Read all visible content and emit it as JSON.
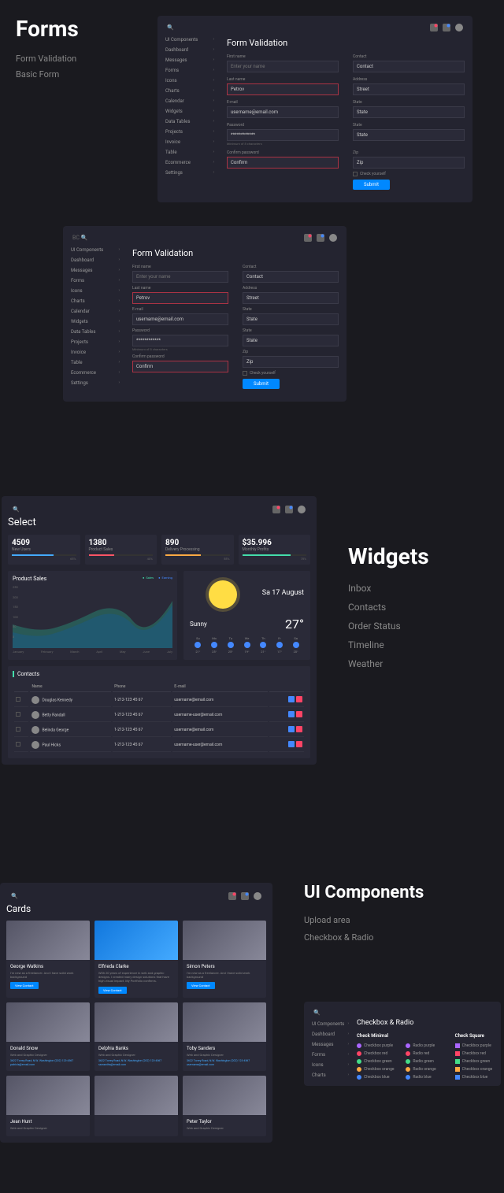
{
  "forms_section": {
    "title": "Forms",
    "links": [
      "Form Validation",
      "Basic Form"
    ]
  },
  "sidebar_items": [
    "UI Components",
    "Dashboard",
    "Messages",
    "Forms",
    "Icons",
    "Charts",
    "Calendar",
    "Widgets",
    "Data Tables",
    "Projects",
    "Invoice",
    "Table",
    "Ecommerce",
    "Settings"
  ],
  "form_validation": {
    "title": "Form Validation",
    "first_name": {
      "label": "First name",
      "placeholder": "Enter your name"
    },
    "last_name": {
      "label": "Last name",
      "value": "Petrov"
    },
    "email": {
      "label": "E-mail",
      "value": "username@email.com"
    },
    "password": {
      "label": "Password",
      "value": "************",
      "helper": "Minimum of 8 characters"
    },
    "confirm": {
      "label": "Confirm password",
      "value": "Confirm"
    },
    "contact": {
      "label": "Contact",
      "value": "Contact"
    },
    "address": {
      "label": "Address",
      "value": "Street"
    },
    "state": {
      "label": "State",
      "value": "State"
    },
    "state2": {
      "label": "State",
      "value": "State"
    },
    "zip": {
      "label": "Zip",
      "value": "Zip"
    },
    "checkbox": "Check yourself",
    "submit": "Submit"
  },
  "widgets_section": {
    "title": "Widgets",
    "links": [
      "Inbox",
      "Contacts",
      "Order Status",
      "Timeline",
      "Weather"
    ]
  },
  "select_page": {
    "title": "Select",
    "stats": [
      {
        "value": "4509",
        "label": "New Users",
        "pct": "65%"
      },
      {
        "value": "1380",
        "label": "Product Sales",
        "pct": "40%"
      },
      {
        "value": "890",
        "label": "Delivery Processing",
        "pct": "55%"
      },
      {
        "value": "$35.996",
        "label": "Monthly Profits",
        "pct": "75%"
      }
    ],
    "chart": {
      "title": "Product Sales",
      "legend": [
        "Sales",
        "Earning"
      ],
      "y_ticks": [
        "250",
        "200",
        "150",
        "100",
        "50",
        "0"
      ],
      "x_ticks": [
        "January",
        "February",
        "March",
        "April",
        "May",
        "June",
        "July"
      ]
    },
    "weather": {
      "date": "Sa 17 August",
      "condition": "Sunny",
      "temp": "27°",
      "days": [
        "Su",
        "Mo",
        "Tu",
        "We",
        "Th",
        "Fr",
        "Sa"
      ],
      "temps": [
        "21°",
        "25°",
        "25°",
        "19°",
        "21°",
        "17°",
        "20°"
      ]
    },
    "contacts": {
      "title": "Contacts",
      "headers": [
        "Name",
        "Phone",
        "E-mail"
      ],
      "rows": [
        {
          "name": "Douglas Kennedy",
          "phone": "1-212-123 45 67",
          "email": "username@email.com"
        },
        {
          "name": "Betty Randall",
          "phone": "1-212-123 45 67",
          "email": "username-user@email.com"
        },
        {
          "name": "Belinda George",
          "phone": "1-212-123 45 67",
          "email": "username@email.com"
        },
        {
          "name": "Paul Hicks",
          "phone": "1-212-123 45 67",
          "email": "username-user@email.com"
        }
      ]
    }
  },
  "ui_section": {
    "title": "UI Components",
    "links": [
      "Upload area",
      "Checkbox & Radio"
    ]
  },
  "cards_page": {
    "title": "Cards",
    "cards": [
      {
        "name": "George Watkins",
        "desc": "I'm new as a freelancer. And I have solid work background",
        "btn": "View Contact"
      },
      {
        "name": "Elfrieda Clarke",
        "desc": "With 20 years of experience in web and graphic designs. I created many design solutions that have high visual impact. My Portfolio confirms.",
        "btn": "View Contact"
      },
      {
        "name": "Simon Peters",
        "desc": "I'm new as a freelancer. And I have solid work background",
        "btn": "View Contact"
      },
      {
        "name": "Donald Snow",
        "desc": "Web and Graphic Designer",
        "meta": "3622 Torrey Road, N.W. Washington\n(202) 123-4567\npatricia@email.com"
      },
      {
        "name": "Delphia Banks",
        "desc": "Web and Graphic Designer",
        "meta": "3622 Torrey Road, N.W. Washington\n(202) 123-4567\nsamantha@email.com"
      },
      {
        "name": "Toby Sanders",
        "desc": "Web and Graphic Designer",
        "meta": "3622 Torrey Road, N.W. Washington\n(202) 123-4567\nusername@email.com"
      },
      {
        "name": "Jean Hunt",
        "desc": "Web and Graphic Designer"
      },
      {
        "name": "",
        "desc": ""
      },
      {
        "name": "Peter Taylor",
        "desc": "Web and Graphic Designer"
      }
    ]
  },
  "checkbox_page": {
    "title": "Checkbox & Radio",
    "col1_title": "Check Minimal",
    "col1": [
      "Checkbox purple",
      "Checkbox red",
      "Checkbox green",
      "Checkbox orange",
      "Checkbox blue"
    ],
    "col2": [
      "Radio purple",
      "Radio red",
      "Radio green",
      "Radio orange",
      "Radio blue"
    ],
    "col3_title": "Check Square",
    "col3": [
      "Checkbox purple",
      "Checkbox red",
      "Checkbox green",
      "Checkbox orange",
      "Checkbox blue"
    ]
  },
  "chart_data": {
    "type": "line",
    "series": [
      {
        "name": "Sales",
        "values": [
          120,
          100,
          80,
          150,
          130,
          110,
          180
        ]
      },
      {
        "name": "Earning",
        "values": [
          90,
          70,
          60,
          130,
          120,
          100,
          170
        ]
      }
    ],
    "categories": [
      "January",
      "February",
      "March",
      "April",
      "May",
      "June",
      "July"
    ],
    "ylim": [
      0,
      250
    ]
  }
}
